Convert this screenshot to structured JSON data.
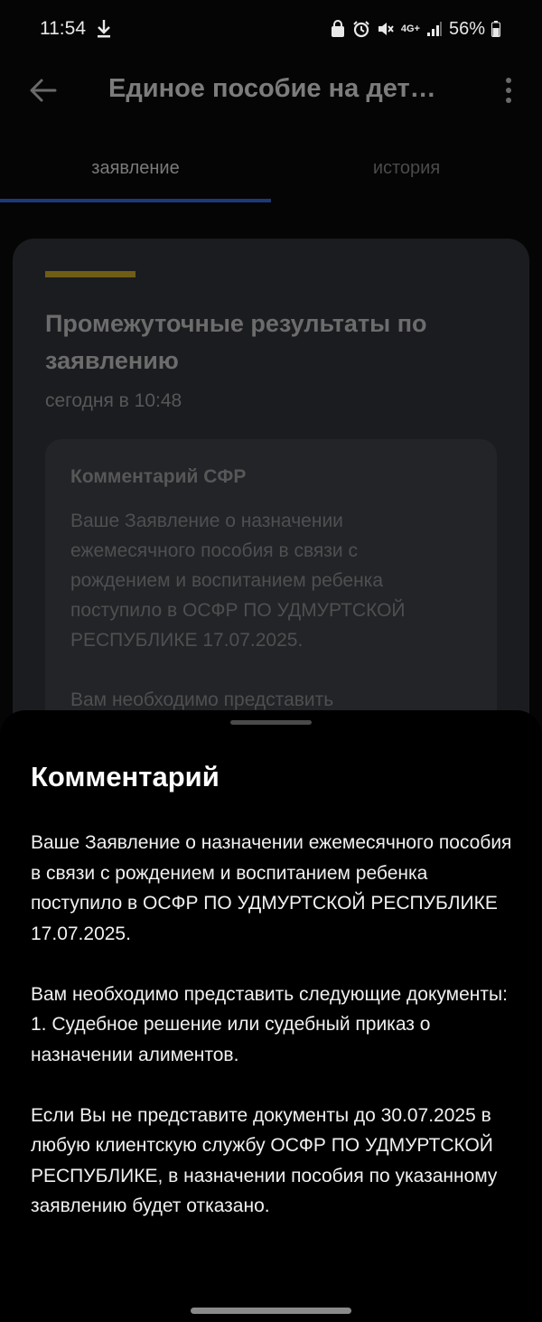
{
  "status_bar": {
    "time": "11:54",
    "network": "4G+",
    "battery": "56%"
  },
  "app_bar": {
    "title": "Единое пособие на дет…",
    "back_icon": "arrow-left-icon",
    "more_icon": "more-vertical-icon"
  },
  "tabs": [
    {
      "label": "заявление",
      "active": true
    },
    {
      "label": "история",
      "active": false
    }
  ],
  "card": {
    "title": "Промежуточные результаты по заявлению",
    "date": "сегодня в 10:48",
    "comment_header": "Комментарий СФР",
    "comment_preview": "Ваше Заявление о назначении ежемесячного пособия в связи с рождением и воспитанием ребенка поступило в ОСФР ПО УДМУРТСКОЙ РЕСПУБЛИКЕ 17.07.2025.\n\nВам необходимо представить"
  },
  "sheet": {
    "title": "Комментарий",
    "text": "Ваше Заявление о назначении ежемесячного пособия в связи с рождением и воспитанием ребенка поступило в ОСФР ПО УДМУРТСКОЙ РЕСПУБЛИКЕ 17.07.2025.\n\nВам необходимо представить следующие документы:\n1. Судебное решение или судебный приказ о назначении алиментов.\n\nЕсли Вы не представите документы до 30.07.2025 в любую клиентскую службу ОСФР ПО УДМУРТСКОЙ РЕСПУБЛИКЕ, в назначении пособия по указанному заявлению будет отказано."
  },
  "colors": {
    "accent_line": "#6f5d16",
    "tab_indicator": "#1c3a7a"
  }
}
